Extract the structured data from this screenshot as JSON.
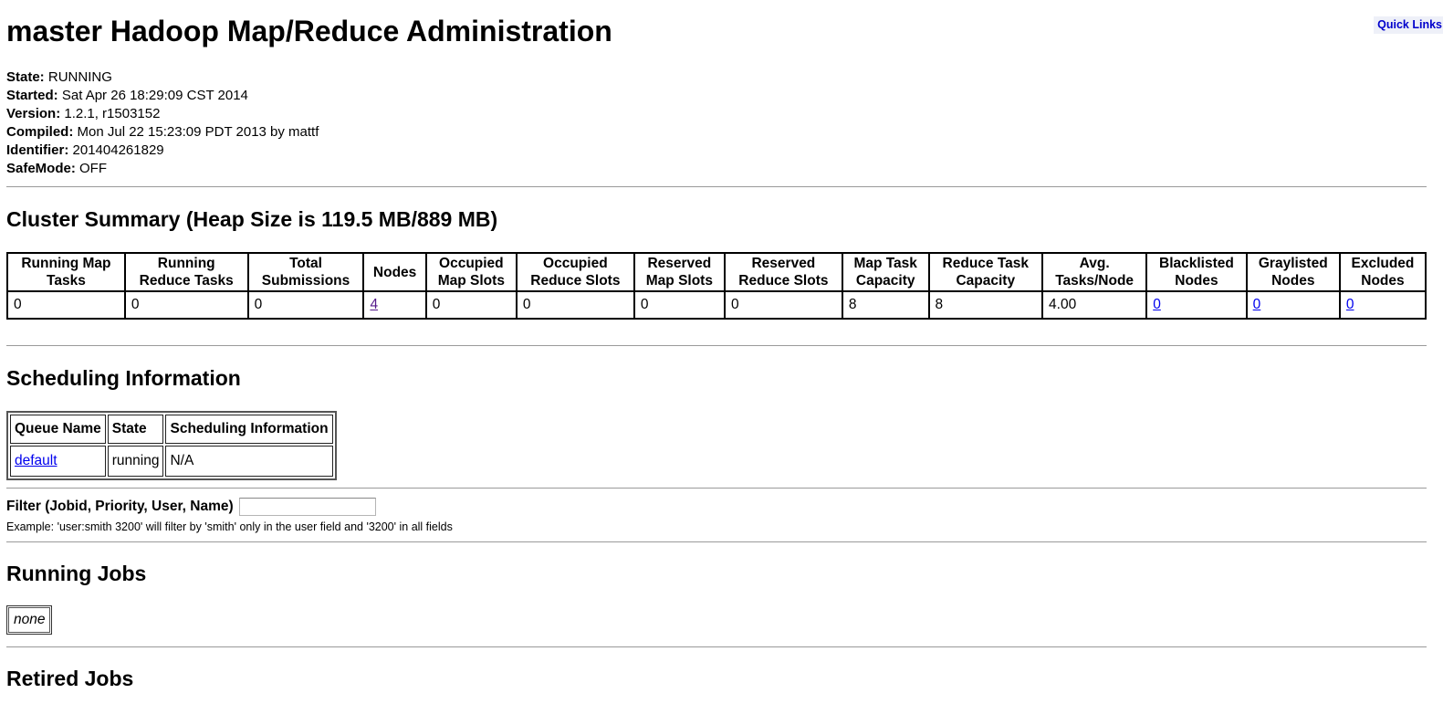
{
  "quick_links": "Quick Links",
  "title": "master Hadoop Map/Reduce Administration",
  "info": [
    {
      "label": "State:",
      "value": "RUNNING"
    },
    {
      "label": "Started:",
      "value": "Sat Apr 26 18:29:09 CST 2014"
    },
    {
      "label": "Version:",
      "value": "1.2.1, r1503152"
    },
    {
      "label": "Compiled:",
      "value": "Mon Jul 22 15:23:09 PDT 2013 by mattf"
    },
    {
      "label": "Identifier:",
      "value": "201404261829"
    },
    {
      "label": "SafeMode:",
      "value": "OFF"
    }
  ],
  "cluster_summary": {
    "heading": "Cluster Summary (Heap Size is 119.5 MB/889 MB)",
    "headers": [
      [
        "Running Map",
        "Tasks"
      ],
      [
        "Running",
        "Reduce Tasks"
      ],
      [
        "Total",
        "Submissions"
      ],
      [
        "Nodes",
        ""
      ],
      [
        "Occupied",
        "Map Slots"
      ],
      [
        "Occupied",
        "Reduce Slots"
      ],
      [
        "Reserved",
        "Map Slots"
      ],
      [
        "Reserved",
        "Reduce Slots"
      ],
      [
        "Map Task",
        "Capacity"
      ],
      [
        "Reduce Task",
        "Capacity"
      ],
      [
        "Avg.",
        "Tasks/Node"
      ],
      [
        "Blacklisted",
        "Nodes"
      ],
      [
        "Graylisted",
        "Nodes"
      ],
      [
        "Excluded",
        "Nodes"
      ]
    ],
    "values": [
      "0",
      "0",
      "0",
      "4",
      "0",
      "0",
      "0",
      "0",
      "8",
      "8",
      "4.00",
      "0",
      "0",
      "0"
    ]
  },
  "scheduling": {
    "heading": "Scheduling Information",
    "headers": [
      "Queue Name",
      "State",
      "Scheduling Information"
    ],
    "row": {
      "queue": "default",
      "state": "running",
      "info": "N/A"
    }
  },
  "filter": {
    "label": "Filter (Jobid, Priority, User, Name)",
    "value": "",
    "example": "Example: 'user:smith 3200' will filter by 'smith' only in the user field and '3200' in all fields"
  },
  "running_jobs": {
    "heading": "Running Jobs",
    "none": "none"
  },
  "retired_jobs": {
    "heading": "Retired Jobs"
  },
  "colors": {
    "link": "#0000ee",
    "visited_link": "#551a8b",
    "quick_links_bg": "#eef0f8"
  }
}
